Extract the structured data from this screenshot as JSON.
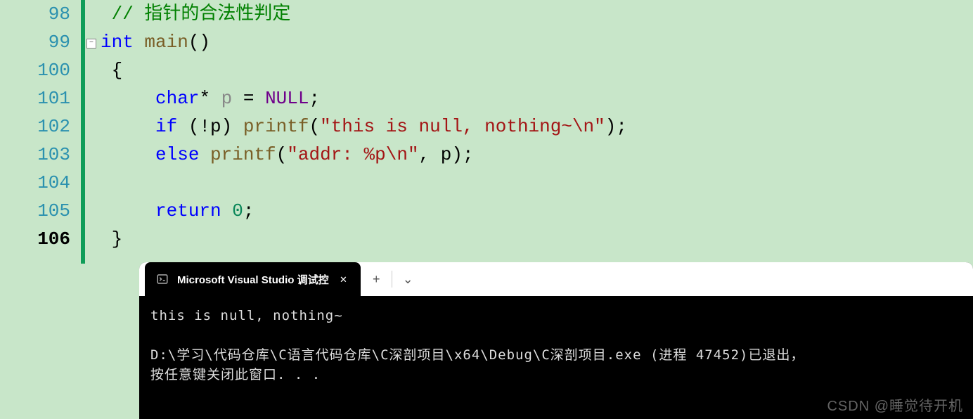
{
  "editor": {
    "lines": [
      {
        "num": "98",
        "current": false
      },
      {
        "num": "99",
        "current": false
      },
      {
        "num": "100",
        "current": false
      },
      {
        "num": "101",
        "current": false
      },
      {
        "num": "102",
        "current": false
      },
      {
        "num": "103",
        "current": false
      },
      {
        "num": "104",
        "current": false
      },
      {
        "num": "105",
        "current": false
      },
      {
        "num": "106",
        "current": true
      }
    ],
    "code": {
      "l98_comment": "// 指针的合法性判定",
      "l99_int": "int",
      "l99_main": " main",
      "l99_paren": "()",
      "l100_brace": "{",
      "l101_char": "char",
      "l101_star": "*",
      "l101_p": " p ",
      "l101_eq": "= ",
      "l101_null": "NULL",
      "l101_semi": ";",
      "l102_if": "if",
      "l102_cond": " (!p) ",
      "l102_printf": "printf",
      "l102_open": "(",
      "l102_str": "\"this is null, nothing~",
      "l102_esc": "\\n",
      "l102_strend": "\"",
      "l102_close": ");",
      "l103_else": "else",
      "l103_sp": " ",
      "l103_printf": "printf",
      "l103_open": "(",
      "l103_str": "\"addr: %p",
      "l103_esc": "\\n",
      "l103_strend": "\"",
      "l103_rest": ", p);",
      "l105_return": "return",
      "l105_sp": " ",
      "l105_zero": "0",
      "l105_semi": ";",
      "l106_brace": "}"
    },
    "fold_symbol": "−"
  },
  "console": {
    "tab_title": "Microsoft Visual Studio 调试控",
    "tab_close": "✕",
    "new_tab": "+",
    "dropdown": "⌄",
    "output_line1": "this is null, nothing~",
    "output_line2": "",
    "output_line3": "D:\\学习\\代码仓库\\C语言代码仓库\\C深剖项目\\x64\\Debug\\C深剖项目.exe (进程 47452)已退出，",
    "output_line4": "按任意键关闭此窗口. . ."
  },
  "watermark": "CSDN @睡觉待开机"
}
